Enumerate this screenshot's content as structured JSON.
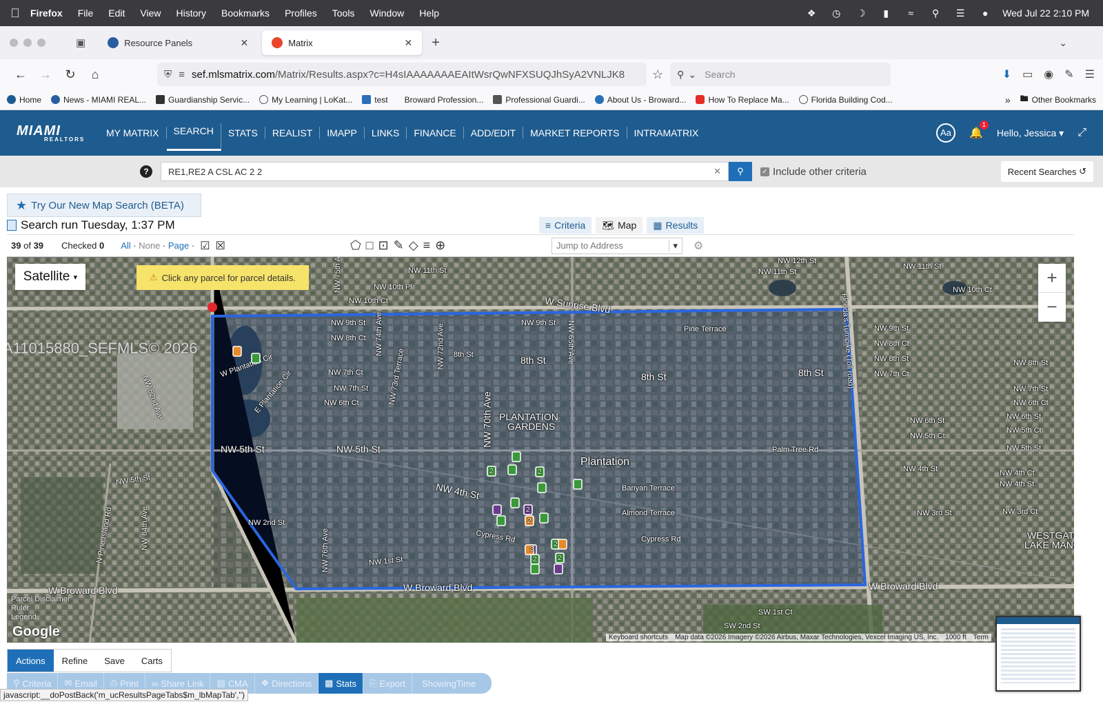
{
  "menubar": {
    "app": "Firefox",
    "items": [
      "File",
      "Edit",
      "View",
      "History",
      "Bookmarks",
      "Profiles",
      "Tools",
      "Window",
      "Help"
    ],
    "clock": "Wed Jul 22  2:10 PM"
  },
  "tabs": [
    {
      "title": "Resource Panels",
      "active": false
    },
    {
      "title": "Matrix",
      "active": true
    }
  ],
  "nav": {
    "url_domain": "sef.mlsmatrix.com",
    "url_path": "/Matrix/Results.aspx?c=H4sIAAAAAAAEAItWsrQwNFXSUQJhSyA2VNLJK8",
    "search_placeholder": "Search"
  },
  "bookmarks": [
    "Home",
    "News - MIAMI REAL...",
    "Guardianship Servic...",
    "My Learning | LoKat...",
    "test",
    "Broward Profession...",
    "Professional Guardi...",
    "About Us - Broward...",
    "How To Replace Ma...",
    "Florida Building Cod..."
  ],
  "bookmarks_more": "Other Bookmarks",
  "app": {
    "logo": "MIAMI",
    "logo_sub": "REALTORS",
    "nav": [
      "MY MATRIX",
      "SEARCH",
      "STATS",
      "REALIST",
      "IMAPP",
      "LINKS",
      "FINANCE",
      "ADD/EDIT",
      "MARKET REPORTS",
      "INTRAMATRIX"
    ],
    "selected_nav": "SEARCH",
    "aa_label": "Aa",
    "notif_count": "1",
    "greeting": "Hello, Jessica"
  },
  "search": {
    "help": "?",
    "query": "RE1,RE2 A CSL AC 2 2",
    "include_other": "Include other criteria",
    "recent": "Recent Searches"
  },
  "beta_link": "Try Our New Map Search (BETA)",
  "run_text": "Search run Tuesday, 1:37 PM",
  "view_tabs": [
    "Criteria",
    "Map",
    "Results"
  ],
  "toolbar": {
    "count": "39",
    "of": "of",
    "total": "39",
    "checked_label": "Checked",
    "checked_count": "0",
    "all": "All",
    "none": "None",
    "page": "Page",
    "jump_placeholder": "Jump to Address"
  },
  "map": {
    "type_button": "Satellite",
    "notice": "Click any parcel for parcel details.",
    "watermark": "A11015880_SEFMLS© 2026",
    "disclaimer": [
      "Parcel Disclaimer",
      "Ruler",
      "Legend"
    ],
    "google": "Google",
    "attribution": [
      "Keyboard shortcuts",
      "Map data ©2026 Imagery ©2026 Airbus, Maxar Technologies, Vexcel Imaging US, Inc.",
      "1000 ft",
      "Term"
    ],
    "labels": [
      "NW 11th St",
      "NW 10th Pl",
      "NW 10th Ct",
      "W Sunrise Blvd",
      "NW 9th St",
      "NW 8th Ct",
      "8th St",
      "NW 7th Ct",
      "NW 7th St",
      "NW 6th Ct",
      "NW 5th St",
      "NW 4th St",
      "NW 2nd St",
      "Cypress Rd",
      "NW 1st St",
      "W Broward Blvd",
      "Pine Terrace",
      "Banyan Terrace",
      "Almond Terrace",
      "Palm Tree Rd",
      "PLANTATION",
      "GARDENS",
      "Plantation",
      "NW 65th Ave",
      "NW 70th Ave",
      "NW 74th Ave",
      "NW 72nd Ave",
      "NW 73rd Terrace",
      "Florida's Turnpike (Toll road)",
      "NW 82nd Ave",
      "N Pine Island Rd",
      "NW 84th Ave",
      "W Plantation Cir",
      "E Plantation Cir",
      "WESTGATE",
      "LAKE MANOR",
      "NW 12th St",
      "NW 8th St",
      "NW 6th St",
      "NW 5th Ct",
      "NW 4th Ct",
      "NW 3rd St",
      "NW 3rd Ct",
      "SW 1st Ct",
      "SW 2nd St",
      "NW 75th Ave",
      "NW 76th Ave"
    ],
    "markers": [
      "2",
      "3",
      "2",
      "2",
      "2",
      "2",
      "2",
      "2"
    ]
  },
  "action_tabs": [
    "Actions",
    "Refine",
    "Save",
    "Carts"
  ],
  "action_buttons": [
    "Criteria",
    "Email",
    "Print",
    "Share Link",
    "CMA",
    "Directions",
    "Stats",
    "Export",
    "ShowingTime"
  ],
  "status_text": "javascript:__doPostBack('m_ucResultsPageTabs$m_lbMapTab','')"
}
